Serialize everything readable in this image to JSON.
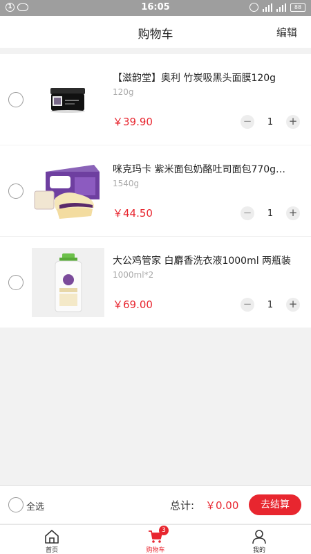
{
  "status_bar": {
    "sim_label": "1",
    "time": "16:05",
    "battery": "88"
  },
  "header": {
    "title": "购物车",
    "edit_label": "编辑"
  },
  "cart": {
    "items": [
      {
        "name": "【滋韵堂】奥利 竹炭吸黑头面膜120g",
        "spec": "120g",
        "price": "￥39.90",
        "quantity": "1",
        "image_icon": "black-face-mask-jar"
      },
      {
        "name": "咪克玛卡  紫米面包奶酪吐司面包770g…",
        "spec": "1540g",
        "price": "￥44.50",
        "quantity": "1",
        "image_icon": "purple-rice-bread-box"
      },
      {
        "name": "大公鸡管家  白麝香洗衣液1000ml 两瓶装",
        "spec": "1000ml*2",
        "price": "￥69.00",
        "quantity": "1",
        "image_icon": "laundry-detergent-bottle"
      }
    ],
    "minus_symbol": "−",
    "plus_symbol": "+"
  },
  "summary": {
    "select_all_label": "全选",
    "total_label": "总计:",
    "total_value": "￥0.00",
    "checkout_label": "去结算"
  },
  "tabbar": {
    "tabs": [
      {
        "label": "首页",
        "icon": "home-icon"
      },
      {
        "label": "购物车",
        "icon": "cart-icon",
        "badge": "3",
        "active": true
      },
      {
        "label": "我的",
        "icon": "user-icon"
      }
    ]
  },
  "colors": {
    "accent": "#e8262f",
    "statusbar": "#9e9e9e",
    "background": "#f2f2f2"
  }
}
